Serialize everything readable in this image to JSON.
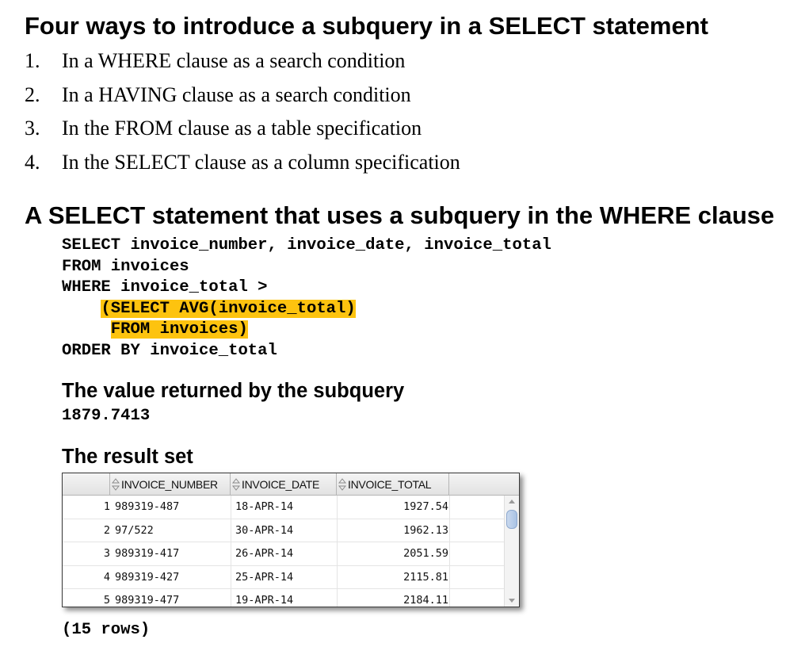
{
  "heading1": "Four ways to introduce a subquery in a SELECT statement",
  "ways": [
    {
      "num": "1.",
      "text": "In a WHERE clause as a search condition"
    },
    {
      "num": "2.",
      "text": "In a HAVING clause as a search condition"
    },
    {
      "num": "3.",
      "text": "In the FROM clause as a table specification"
    },
    {
      "num": "4.",
      "text": "In the SELECT clause as a column specification"
    }
  ],
  "heading2": "A SELECT statement that uses a subquery in the WHERE clause",
  "code": {
    "line1": "SELECT invoice_number, invoice_date, invoice_total",
    "line2": "FROM invoices",
    "line3": "WHERE invoice_total >",
    "line4_indent": "    ",
    "line4": "(SELECT AVG(invoice_total)",
    "line5_indent": "     ",
    "line5": "FROM invoices)",
    "line6": "ORDER BY invoice_total",
    "highlight_color": "#fdc30f"
  },
  "subquery_heading": "The value returned by the subquery",
  "subquery_value": "1879.7413",
  "result_heading": "The result set",
  "result_grid": {
    "columns": [
      "INVOICE_NUMBER",
      "INVOICE_DATE",
      "INVOICE_TOTAL"
    ],
    "rows": [
      {
        "idx": "1",
        "invoice_number": "989319-487",
        "invoice_date": "18-APR-14",
        "invoice_total": "1927.54"
      },
      {
        "idx": "2",
        "invoice_number": "97/522",
        "invoice_date": "30-APR-14",
        "invoice_total": "1962.13"
      },
      {
        "idx": "3",
        "invoice_number": "989319-417",
        "invoice_date": "26-APR-14",
        "invoice_total": "2051.59"
      },
      {
        "idx": "4",
        "invoice_number": "989319-427",
        "invoice_date": "25-APR-14",
        "invoice_total": "2115.81"
      },
      {
        "idx": "5",
        "invoice_number": "989319-477",
        "invoice_date": "19-APR-14",
        "invoice_total": "2184.11"
      }
    ]
  },
  "row_count": "(15 rows)"
}
